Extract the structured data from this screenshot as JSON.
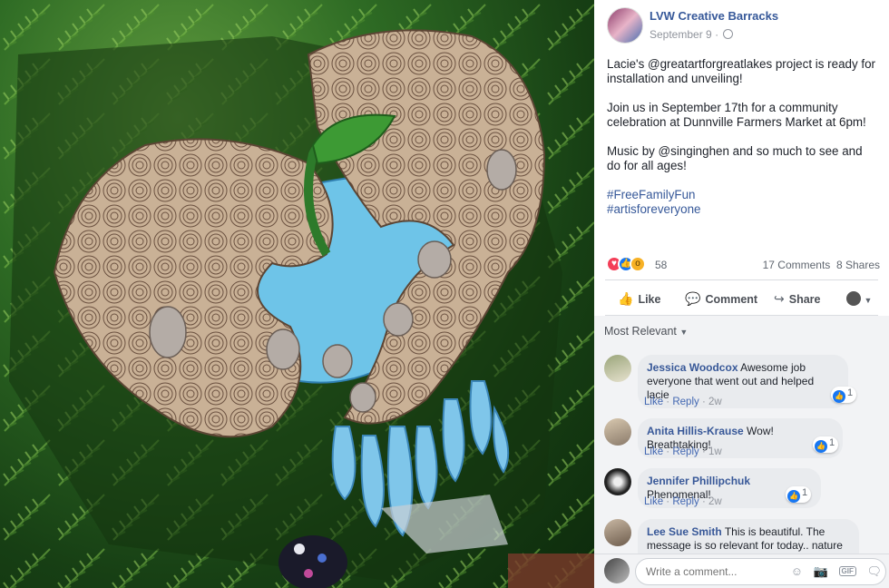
{
  "post": {
    "page_name": "LVW Creative Barracks",
    "date": "September 9",
    "privacy_sep": "·",
    "paragraphs": [
      "Lacie's @greatartforgreatlakes project is ready for installation and unveiling!",
      "Join us in September 17th for a community celebration at Dunnville Farmers Market at 6pm!",
      "Music by @singinghen and so much to see and do for all ages!"
    ],
    "hashtags": [
      "#FreeFamilyFun",
      "#artisforeveryone"
    ]
  },
  "reactions": {
    "count": "58",
    "comments": "17 Comments",
    "shares": "8 Shares",
    "icons": [
      "love-icon",
      "like-icon",
      "wow-icon"
    ]
  },
  "actions": {
    "like": "Like",
    "comment": "Comment",
    "share": "Share"
  },
  "comments_section": {
    "sort_label": "Most Relevant",
    "items": [
      {
        "name": "Jessica Woodcox",
        "text": "Awesome job everyone that went out and helped lacie",
        "like": "Like",
        "reply": "Reply",
        "time": "2w",
        "likes": "1"
      },
      {
        "name": "Anita Hillis-Krause",
        "text": "Wow! Breathtaking!",
        "like": "Like",
        "reply": "Reply",
        "time": "1w",
        "likes": "1"
      },
      {
        "name": "Jennifer Phillipchuk",
        "text": "Phenomenal!",
        "like": "Like",
        "reply": "Reply",
        "time": "2w",
        "likes": "1"
      },
      {
        "name": "Lee Sue Smith",
        "text": "This is beautiful. The message is so relevant for today.. nature is"
      }
    ]
  },
  "composer": {
    "placeholder": "Write a comment..."
  },
  "colors": {
    "link_blue": "#365899",
    "like_blue": "#1877f2",
    "love_red": "#f33e58",
    "wow_yellow": "#f7b125"
  }
}
